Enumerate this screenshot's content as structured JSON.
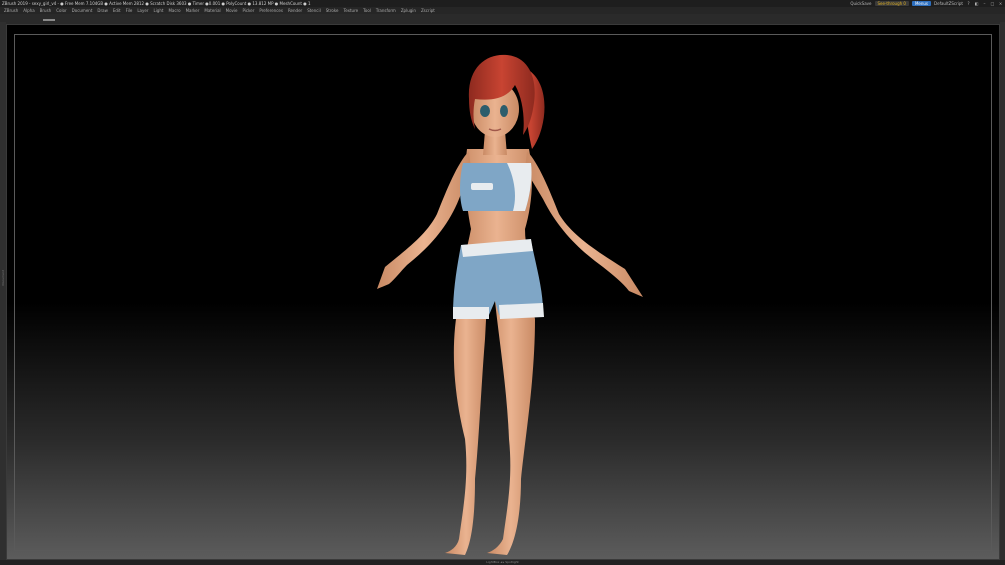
{
  "titlebar": {
    "title": "ZBrush 2019 - sexy_girl_v4 - ● Free Mem 7.104GB ● Active Mem 2812 ● Scratch Disk 3603 ● Timer ●0.001 ● PolyCount ● 13.812 MP ● MeshCount ● 1",
    "quicksave": "QuickSave",
    "see_through": "See-through 0",
    "menus_button": "Menus",
    "default_zscript": "DefaultZScript"
  },
  "menubar": {
    "items": [
      "ZBrush",
      "Alpha",
      "Brush",
      "Color",
      "Document",
      "Draw",
      "Edit",
      "File",
      "Layer",
      "Light",
      "Macro",
      "Marker",
      "Material",
      "Movie",
      "Picker",
      "Preferences",
      "Render",
      "Stencil",
      "Stroke",
      "Texture",
      "Tool",
      "Transform",
      "Zplugin",
      "Zscript"
    ]
  },
  "viewport": {
    "bottom_label": "LightBox ◂ ▸ Spotlight",
    "side_label": "Document"
  },
  "colors": {
    "skin": "#e6a880",
    "hair": "#b83a2a",
    "clothing_blue": "#7fa6c6",
    "clothing_white": "#e8ecef"
  }
}
